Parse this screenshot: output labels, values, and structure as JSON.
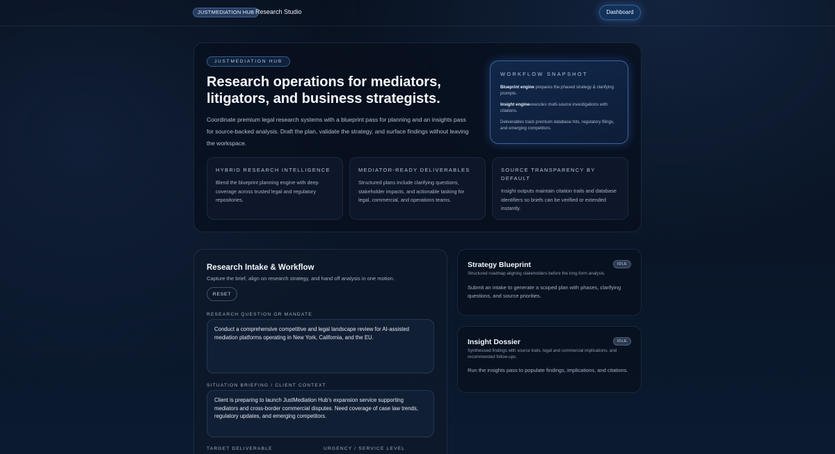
{
  "topbar": {
    "brand": "JUSTMEDIATION HUB",
    "title": "Research Studio",
    "dashboard_label": "Dashboard"
  },
  "hero": {
    "pill": "JUSTMEDIATION HUB",
    "title": "Research operations for mediators, litigators, and business strategists.",
    "description": "Coordinate premium legal research systems with a blueprint pass for planning and an insights pass for source-backed analysis. Draft the plan, validate the strategy, and surface findings without leaving the workspace.",
    "snapshot": {
      "title": "WORKFLOW SNAPSHOT",
      "items": [
        {
          "bold": "Blueprint engine",
          "text": " prepares the phased strategy & clarifying prompts."
        },
        {
          "bold": "Insight engine",
          "text": "executes multi-source investigations with citations."
        },
        {
          "bold": "",
          "text": "Deliverables track premium database hits, regulatory filings, and emerging competitors."
        }
      ]
    },
    "features": [
      {
        "title": "HYBRID RESEARCH INTELLIGENCE",
        "body": "Blend the blueprint planning engine with deep coverage across trusted legal and regulatory repositories."
      },
      {
        "title": "MEDIATOR-READY DELIVERABLES",
        "body": "Structured plans include clarifying questions, stakeholder impacts, and actionable tasking for legal, commercial, and operations teams."
      },
      {
        "title": "SOURCE TRANSPARENCY BY DEFAULT",
        "body": "Insight outputs maintain citation trails and database identifiers so briefs can be verified or extended instantly."
      }
    ]
  },
  "intake": {
    "title": "Research Intake & Workflow",
    "subtitle": "Capture the brief, align on research strategy, and hand off analysis in one motion.",
    "reset_label": "RESET",
    "question_label": "RESEARCH QUESTION OR MANDATE",
    "question_value": "Conduct a comprehensive competitive and legal landscape review for AI-assisted mediation platforms operating in New York, California, and the EU.",
    "context_label": "SITUATION BRIEFING / CLIENT CONTEXT",
    "context_value": "Client is preparing to launch JustMediation Hub's expansion service supporting mediators and cross-border commercial disputes. Need coverage of case law trends, regulatory updates, and emerging competitors.",
    "deliverable_label": "TARGET DELIVERABLE",
    "urgency_label": "URGENCY / SERVICE LEVEL"
  },
  "blueprint": {
    "title": "Strategy Blueprint",
    "badge": "IDLE",
    "subtitle": "Structured roadmap aligning stakeholders before the long-form analysis.",
    "body": "Submit an intake to generate a scoped plan with phases, clarifying questions, and source priorities."
  },
  "dossier": {
    "title": "Insight Dossier",
    "badge": "IDLE",
    "subtitle": "Synthesised findings with source trails, legal and commercial implications, and recommended follow-ups.",
    "body": "Run the insights pass to populate findings, implications, and citations."
  }
}
